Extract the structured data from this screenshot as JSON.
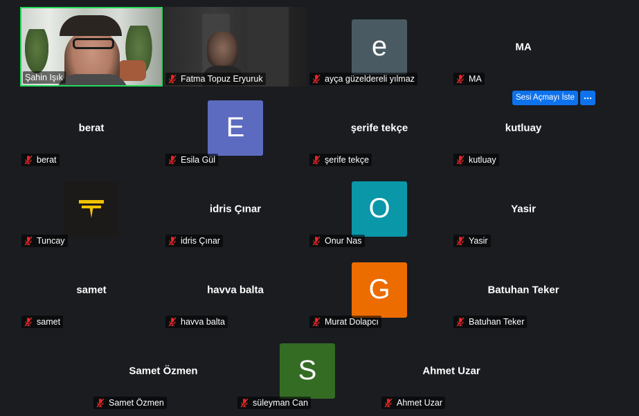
{
  "toolbar": {
    "unmute_request_label": "Sesi Açmayı İste",
    "more_icon": "ellipsis-icon"
  },
  "colors": {
    "background": "#1a1c20",
    "active_speaker_border": "#23d959",
    "button_blue": "#0e72ed",
    "mic_muted_red": "#e02828"
  },
  "participants": [
    {
      "name": "Şahin Işık",
      "type": "video",
      "active": true
    },
    {
      "name": "Fatma Topuz Eryuruk",
      "type": "video"
    },
    {
      "name": "ayça güzeldereli yılmaz",
      "type": "avatar",
      "initial": "e",
      "color": "#4a5a63"
    },
    {
      "name": "MA",
      "type": "name",
      "display": "MA"
    },
    {
      "name": "berat",
      "type": "name",
      "display": "berat"
    },
    {
      "name": "Esila Gül",
      "type": "avatar",
      "initial": "E",
      "color": "#5c6bc0"
    },
    {
      "name": "şerife tekçe",
      "type": "name",
      "display": "şerife tekçe"
    },
    {
      "name": "kutluay",
      "type": "name",
      "display": "kutluay"
    },
    {
      "name": "Tuncay",
      "type": "logo",
      "logo_icon": "t-logo-icon"
    },
    {
      "name": "idris Çınar",
      "type": "name",
      "display": "idris Çınar"
    },
    {
      "name": "Onur Nas",
      "type": "avatar",
      "initial": "O",
      "color": "#0a97a8"
    },
    {
      "name": "Yasir",
      "type": "name",
      "display": "Yasir"
    },
    {
      "name": "samet",
      "type": "name",
      "display": "samet"
    },
    {
      "name": "havva balta",
      "type": "name",
      "display": "havva balta"
    },
    {
      "name": "Murat Dolapcı",
      "type": "avatar",
      "initial": "G",
      "color": "#ec6c00"
    },
    {
      "name": "Batuhan Teker",
      "type": "name",
      "display": "Batuhan Teker"
    },
    {
      "name": "Samet Özmen",
      "type": "name",
      "display": "Samet Özmen"
    },
    {
      "name": "süleyman Can",
      "type": "avatar",
      "initial": "S",
      "color": "#356c24"
    },
    {
      "name": "Ahmet Uzar",
      "type": "name",
      "display": "Ahmet Uzar"
    }
  ]
}
